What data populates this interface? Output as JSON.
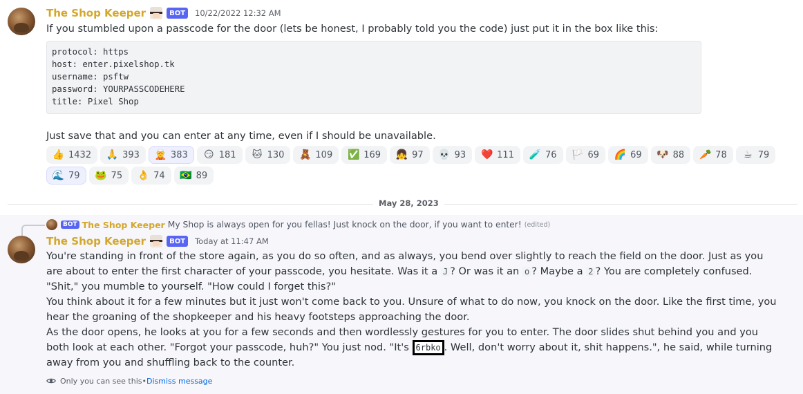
{
  "message1": {
    "username": "The Shop Keeper",
    "bot_tag": "BOT",
    "timestamp": "10/22/2022 12:32 AM",
    "intro": "If you stumbled upon a passcode for the door (lets be honest, I probably told you the code) just put it in the box like this:",
    "code_lines": [
      "protocol: https",
      "host: enter.pixelshop.tk",
      "username: psftw",
      "password: YOURPASSCODEHERE",
      "title: Pixel Shop"
    ],
    "outro": "Just save that and you can enter at any time, even if I should be unavailable.",
    "reactions_row1": [
      {
        "icon": "thumbs-up-emoji",
        "glyph": "👍",
        "count": "1432"
      },
      {
        "icon": "folded-hands-emoji",
        "glyph": "🙏",
        "count": "393"
      },
      {
        "icon": "custom-shopkeeper-emoji",
        "glyph": "🧝",
        "count": "383",
        "me": true
      },
      {
        "icon": "smirk-emoji",
        "glyph": "😏",
        "count": "181"
      },
      {
        "icon": "custom-anime-emoji",
        "glyph": "🐱",
        "count": "130"
      },
      {
        "icon": "custom-pixel-emoji",
        "glyph": "🧸",
        "count": "109"
      },
      {
        "icon": "check-mark-emoji",
        "glyph": "✅",
        "count": "169"
      },
      {
        "icon": "custom-girl-emoji",
        "glyph": "👧",
        "count": "97"
      },
      {
        "icon": "skull-emoji",
        "glyph": "💀",
        "count": "93"
      },
      {
        "icon": "heart-emoji",
        "glyph": "❤️",
        "count": "111"
      },
      {
        "icon": "potion-emoji",
        "glyph": "🧪",
        "count": "76"
      },
      {
        "icon": "trans-flag-emoji",
        "glyph": "🏳️",
        "count": "69"
      },
      {
        "icon": "custom-rainbow-emoji",
        "glyph": "🌈",
        "count": "69"
      },
      {
        "icon": "custom-dog-emoji",
        "glyph": "🐶",
        "count": "88"
      },
      {
        "icon": "carrot-emoji",
        "glyph": "🥕",
        "count": "78"
      },
      {
        "icon": "coffee-emoji",
        "glyph": "☕",
        "count": "79"
      }
    ],
    "reactions_row2": [
      {
        "icon": "custom-wave-emoji",
        "glyph": "🌊",
        "count": "79",
        "me": true
      },
      {
        "icon": "custom-frog-emoji",
        "glyph": "🐸",
        "count": "75"
      },
      {
        "icon": "ok-hand-emoji",
        "glyph": "👌",
        "count": "74"
      },
      {
        "icon": "brazil-flag-emoji",
        "glyph": "🇧🇷",
        "count": "89"
      }
    ]
  },
  "date_divider": "May 28, 2023",
  "message2": {
    "reply": {
      "bot_tag": "BOT",
      "username": "The Shop Keeper",
      "text": "My Shop is always open for you fellas! Just knock on the door, if you want to enter!",
      "edited": "(edited)"
    },
    "username": "The Shop Keeper",
    "bot_tag": "BOT",
    "timestamp": "Today at 11:47 AM",
    "p1_a": "You're standing in front of the store again, as you do so often, and as always, you bend over slightly to reach the field on the door. Just as you are about to enter the first character of your passcode, you hesitate. Was it a ",
    "code_j": "J",
    "p1_b": "? Or was it an ",
    "code_o": "o",
    "p1_c": "? Maybe a ",
    "code_2": "2",
    "p1_d": "? You are completely confused.",
    "p2": "\"Shit,\" you mumble to yourself. \"How could I forget this?\"",
    "p3": "You think about it for a few minutes but it just won't come back to you. Unsure of what to do now, you knock on the door. Like the first time, you hear the groaning of the shopkeeper and his heavy footsteps approaching the door.",
    "p4_a": "As the door opens, he looks at you for a few seconds and then wordlessly gestures for you to enter. The door slides shut behind you and you both look at each other. \"Forgot your passcode, huh?\" You just nod. \"It's ",
    "passcode": "6rbko",
    "p4_b": ". Well, don't worry about it, shit happens.\", he said, while turning away from you and shuffling back to the counter.",
    "ephemeral_text": "Only you can see this",
    "ephemeral_sep": " • ",
    "dismiss": "Dismiss message"
  }
}
